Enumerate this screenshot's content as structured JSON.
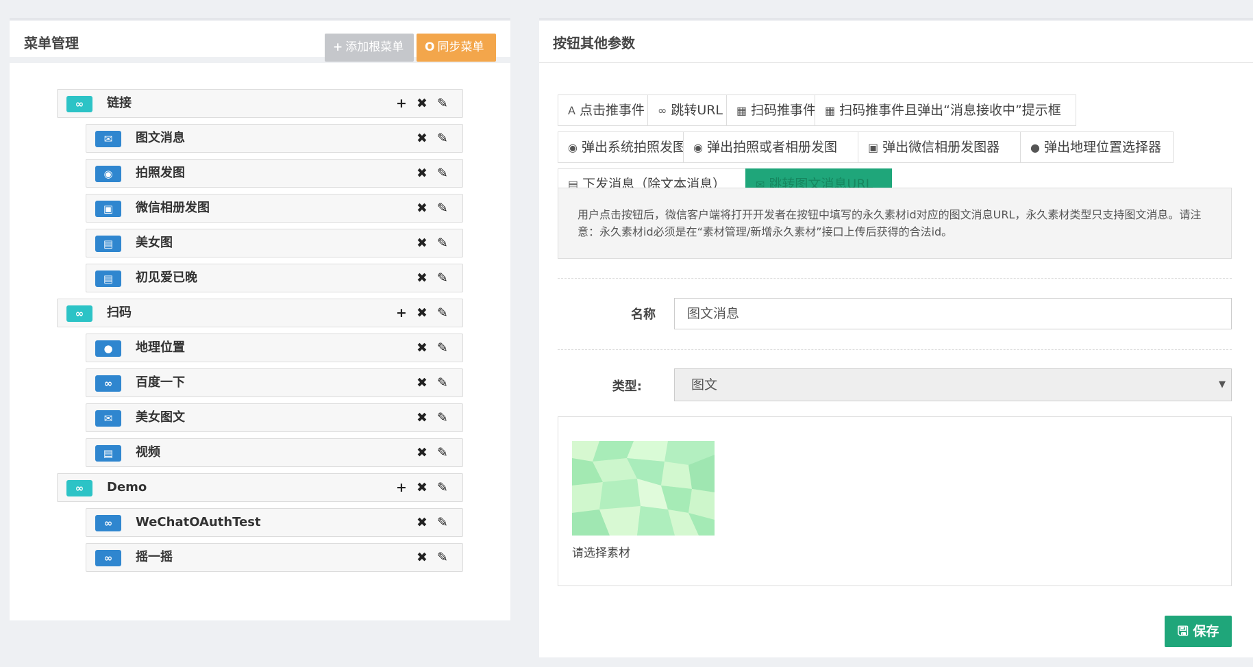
{
  "menu_panel": {
    "title": "菜单管理",
    "add_root_label": "添加根菜单",
    "sync_label": "同步菜单",
    "add_icon": "+",
    "sync_icon": "O"
  },
  "tree": {
    "items": [
      {
        "label": "链接",
        "level": "root",
        "icon": "link-icon"
      },
      {
        "label": "图文消息",
        "level": "child",
        "icon": "envelope-icon"
      },
      {
        "label": "拍照发图",
        "level": "child",
        "icon": "camera-icon"
      },
      {
        "label": "微信相册发图",
        "level": "child",
        "icon": "picture-icon"
      },
      {
        "label": "美女图",
        "level": "child",
        "icon": "newspaper-icon"
      },
      {
        "label": "初见爱已晚",
        "level": "child",
        "icon": "newspaper-icon"
      },
      {
        "label": "扫码",
        "level": "root",
        "icon": "link-icon"
      },
      {
        "label": "地理位置",
        "level": "child",
        "icon": "map-marker-icon"
      },
      {
        "label": "百度一下",
        "level": "child",
        "icon": "link-icon"
      },
      {
        "label": "美女图文",
        "level": "child",
        "icon": "envelope-icon"
      },
      {
        "label": "视频",
        "level": "child",
        "icon": "newspaper-icon"
      },
      {
        "label": "Demo",
        "level": "root",
        "icon": "link-icon"
      },
      {
        "label": "WeChatOAuthTest",
        "level": "child",
        "icon": "link-icon"
      },
      {
        "label": "摇一摇",
        "level": "child",
        "icon": "link-icon"
      }
    ]
  },
  "params_panel": {
    "title": "按钮其他参数",
    "event_buttons": [
      {
        "label": "点击推事件",
        "icon": "font-icon"
      },
      {
        "label": "跳转URL",
        "icon": "link-icon"
      },
      {
        "label": "扫码推事件",
        "icon": "qrcode-icon"
      },
      {
        "label": "扫码推事件且弹出“消息接收中”提示框",
        "icon": "qrcode-icon"
      },
      {
        "label": "弹出系统拍照发图",
        "icon": "camera-icon"
      },
      {
        "label": "弹出拍照或者相册发图",
        "icon": "camera-icon"
      },
      {
        "label": "弹出微信相册发图器",
        "icon": "picture-icon"
      },
      {
        "label": "弹出地理位置选择器",
        "icon": "map-marker-icon"
      },
      {
        "label": "下发消息（除文本消息）",
        "icon": "newspaper-icon"
      },
      {
        "label": "跳转图文消息URL",
        "icon": "envelope-icon"
      }
    ],
    "active_event": "跳转图文消息URL",
    "info_text": "用户点击按钮后，微信客户端将打开开发者在按钮中填写的永久素材id对应的图文消息URL，永久素材类型只支持图文消息。请注意：永久素材id必须是在“素材管理/新增永久素材”接口上传后获得的合法id。",
    "name_label": "名称",
    "name_value": "图文消息",
    "type_label": "类型:",
    "type_value": "图文",
    "material_caption": "请选择素材",
    "save_label": "保存"
  },
  "colors": {
    "accent_green": "#1fa67a",
    "sync_orange": "#f3a64b",
    "root_icon": "#2cc3c6",
    "child_icon": "#2f86cf"
  }
}
